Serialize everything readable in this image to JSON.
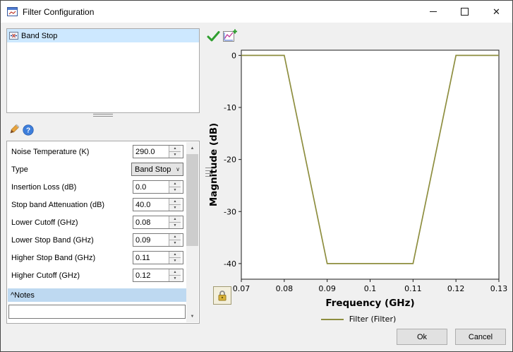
{
  "window": {
    "title": "Filter Configuration",
    "controls": {
      "close_glyph": "✕"
    }
  },
  "component_list": {
    "items": [
      {
        "label": "Band Stop",
        "selected": true
      }
    ]
  },
  "icons": {
    "edit": "pencil-icon",
    "help": "help-icon",
    "apply": "check-icon",
    "plot": "chart-icon",
    "lock": "lock-icon"
  },
  "properties": {
    "rows": [
      {
        "label": "Noise Temperature (K)",
        "value": "290.0",
        "control": "spinner"
      },
      {
        "label": "Type",
        "value": "Band Stop",
        "control": "dropdown"
      },
      {
        "label": "Insertion Loss (dB)",
        "value": "0.0",
        "control": "spinner"
      },
      {
        "label": "Stop band Attenuation (dB)",
        "value": "40.0",
        "control": "spinner"
      },
      {
        "label": "Lower Cutoff  (GHz)",
        "value": "0.08",
        "control": "spinner"
      },
      {
        "label": "Lower Stop Band  (GHz)",
        "value": "0.09",
        "control": "spinner"
      },
      {
        "label": "Higher Stop Band  (GHz)",
        "value": "0.11",
        "control": "spinner"
      },
      {
        "label": "Higher Cutoff  (GHz)",
        "value": "0.12",
        "control": "spinner"
      }
    ],
    "notes_header": "^Notes",
    "notes_value": ""
  },
  "chart_data": {
    "type": "line",
    "title": "",
    "xlabel": "Frequency (GHz)",
    "ylabel": "Magnitude (dB)",
    "xlim": [
      0.07,
      0.13
    ],
    "ylim": [
      -43,
      1
    ],
    "xticks": [
      0.07,
      0.08,
      0.09,
      0.1,
      0.11,
      0.12,
      0.13
    ],
    "yticks": [
      0,
      -10,
      -20,
      -30,
      -40
    ],
    "grid": false,
    "legend_position": "bottom",
    "series": [
      {
        "name": "Filter (Filter)",
        "color": "#8e8e3f",
        "x": [
          0.07,
          0.08,
          0.09,
          0.11,
          0.12,
          0.13
        ],
        "y": [
          0,
          0,
          -40,
          -40,
          0,
          0
        ]
      }
    ]
  },
  "footer": {
    "ok_label": "Ok",
    "cancel_label": "Cancel"
  }
}
